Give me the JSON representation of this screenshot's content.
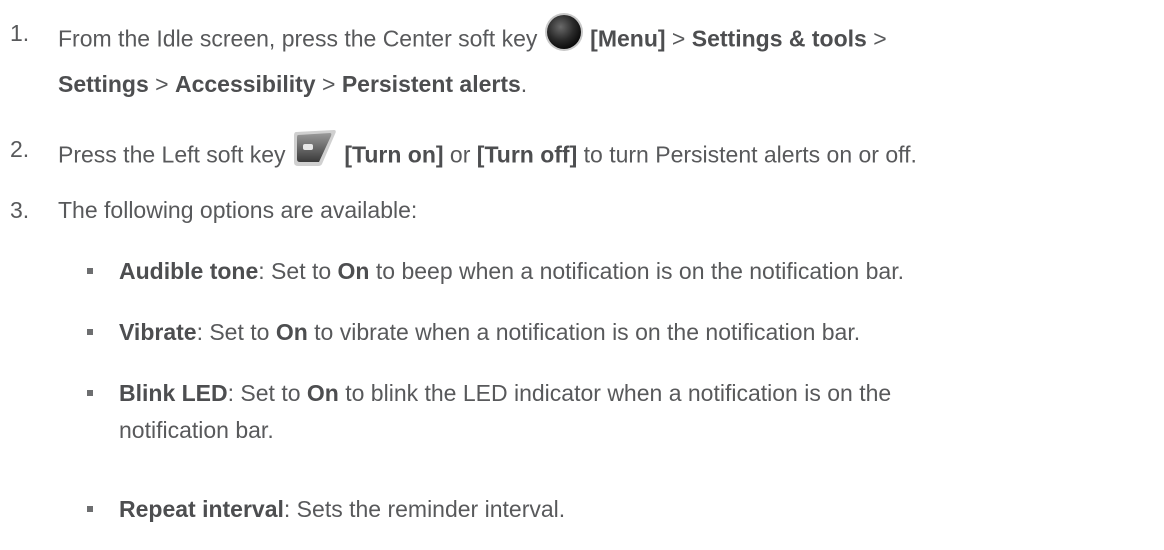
{
  "steps": [
    {
      "num": "1.",
      "parts": [
        "From the Idle screen, press the Center soft key ",
        "[Menu]",
        " > ",
        "Settings & tools",
        " > ",
        "Settings",
        " > ",
        "Accessibility",
        " > ",
        "Persistent alerts",
        "."
      ]
    },
    {
      "num": "2.",
      "parts": [
        "Press the Left soft key ",
        "[Turn on]",
        " or ",
        "[Turn off]",
        " to turn Persistent alerts on or off."
      ]
    },
    {
      "num": "3.",
      "parts": [
        "The following options are available:"
      ]
    }
  ],
  "options": [
    {
      "term": "Audible tone",
      "sep": ": Set to ",
      "val": "On",
      "rest": " to beep when a notification is on the notification bar."
    },
    {
      "term": "Vibrate",
      "sep": ": Set to ",
      "val": "On",
      "rest": " to vibrate when a notification is on the notification bar."
    },
    {
      "term": "Blink LED",
      "sep": ": Set to ",
      "val": "On",
      "rest": " to blink the LED indicator when a notification is on the notification bar."
    },
    {
      "term": "Repeat interval",
      "rest": ": Sets the reminder interval."
    }
  ],
  "icons": {
    "center_key": "center-soft-key-icon",
    "left_key": "left-soft-key-icon"
  }
}
